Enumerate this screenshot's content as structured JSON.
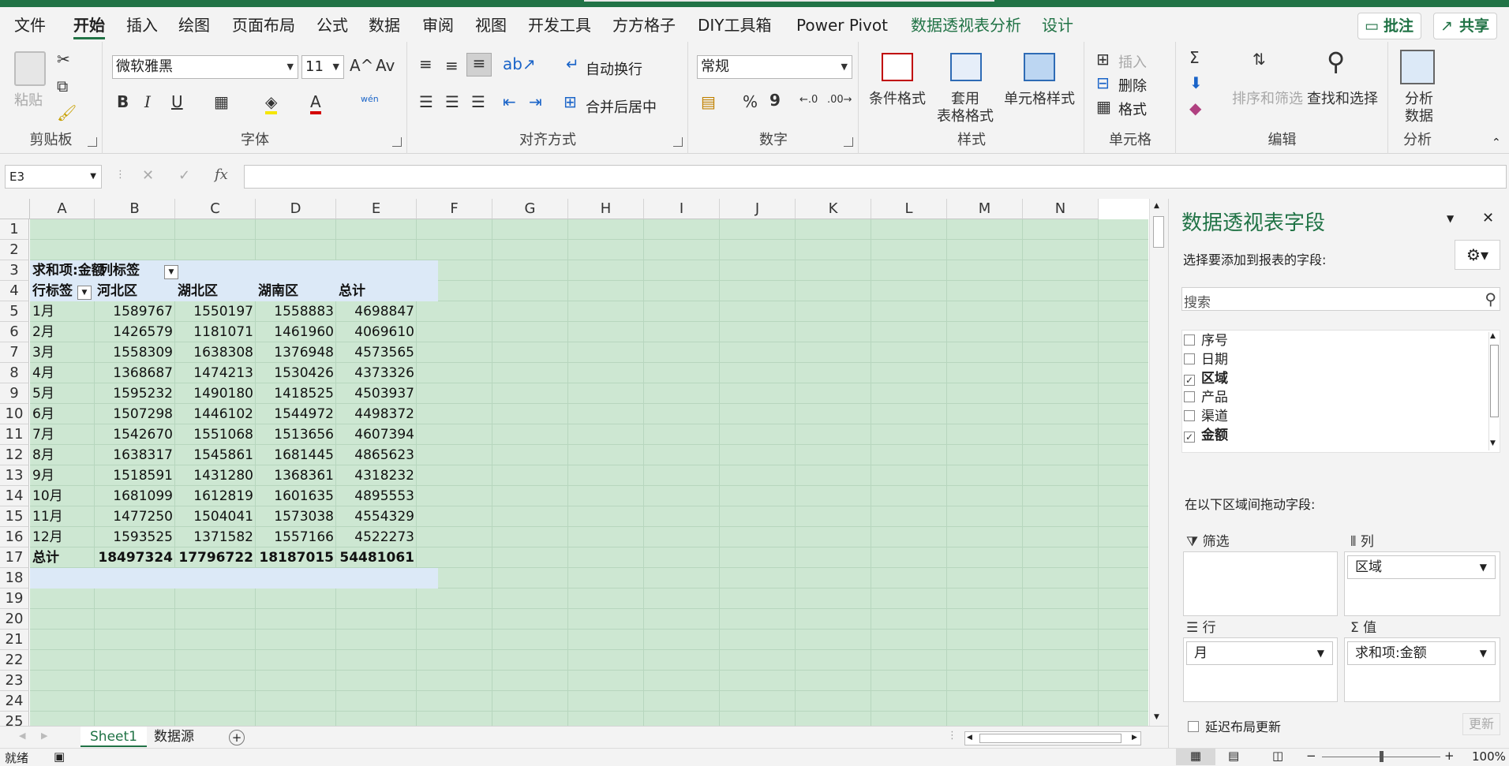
{
  "ribbon_tabs": [
    "文件",
    "开始",
    "插入",
    "绘图",
    "页面布局",
    "公式",
    "数据",
    "审阅",
    "视图",
    "开发工具",
    "方方格子",
    "DIY工具箱",
    "Power Pivot",
    "数据透视表分析",
    "设计"
  ],
  "top_buttons": {
    "comment": "批注",
    "share": "共享",
    "comment_icon": "comment-icon",
    "share_icon": "share-icon"
  },
  "groups": {
    "clipboard": {
      "label": "剪贴板",
      "paste": "粘贴"
    },
    "font": {
      "label": "字体",
      "name": "微软雅黑",
      "size": "11",
      "bold": "B",
      "italic": "I",
      "underline": "U",
      "grow": "A^",
      "shrink": "Av",
      "phonetic": "wén"
    },
    "alignment": {
      "label": "对齐方式",
      "wrap": "自动换行",
      "merge": "合并后居中"
    },
    "number": {
      "label": "数字",
      "format": "常规",
      "percent": "%",
      "comma": "9"
    },
    "styles": {
      "label": "样式",
      "conditional": "条件格式",
      "table_line1": "套用",
      "table_line2": "表格格式",
      "cell_styles": "单元格样式"
    },
    "cells": {
      "label": "单元格",
      "insert": "插入",
      "delete": "删除",
      "format": "格式"
    },
    "editing": {
      "label": "编辑",
      "sort": "排序和筛选",
      "find": "查找和选择"
    },
    "analysis": {
      "label": "分析",
      "analyze_line1": "分析",
      "analyze_line2": "数据"
    }
  },
  "formula_bar": {
    "name_box": "E3",
    "fx": "fx",
    "value": ""
  },
  "columns": [
    "A",
    "B",
    "C",
    "D",
    "E",
    "F",
    "G",
    "H",
    "I",
    "J",
    "K",
    "L",
    "M",
    "N"
  ],
  "rows": [
    "1",
    "2",
    "3",
    "4",
    "5",
    "6",
    "7",
    "8",
    "9",
    "10",
    "11",
    "12",
    "13",
    "14",
    "15",
    "16",
    "17",
    "18",
    "19",
    "20",
    "21",
    "22",
    "23",
    "24",
    "25"
  ],
  "pivot": {
    "value_label": "求和项:金额",
    "col_label": "列标签",
    "row_label": "行标签",
    "headers": [
      "河北区",
      "湖北区",
      "湖南区",
      "总计"
    ],
    "data": [
      [
        "1月",
        "1589767",
        "1550197",
        "1558883",
        "4698847"
      ],
      [
        "2月",
        "1426579",
        "1181071",
        "1461960",
        "4069610"
      ],
      [
        "3月",
        "1558309",
        "1638308",
        "1376948",
        "4573565"
      ],
      [
        "4月",
        "1368687",
        "1474213",
        "1530426",
        "4373326"
      ],
      [
        "5月",
        "1595232",
        "1490180",
        "1418525",
        "4503937"
      ],
      [
        "6月",
        "1507298",
        "1446102",
        "1544972",
        "4498372"
      ],
      [
        "7月",
        "1542670",
        "1551068",
        "1513656",
        "4607394"
      ],
      [
        "8月",
        "1638317",
        "1545861",
        "1681445",
        "4865623"
      ],
      [
        "9月",
        "1518591",
        "1431280",
        "1368361",
        "4318232"
      ],
      [
        "10月",
        "1681099",
        "1612819",
        "1601635",
        "4895553"
      ],
      [
        "11月",
        "1477250",
        "1504041",
        "1573038",
        "4554329"
      ],
      [
        "12月",
        "1593525",
        "1371582",
        "1557166",
        "4522273"
      ]
    ],
    "total": [
      "总计",
      "18497324",
      "17796722",
      "18187015",
      "54481061"
    ]
  },
  "sheet_tabs": [
    "Sheet1",
    "数据源"
  ],
  "status": {
    "ready": "就绪",
    "zoom": "100%"
  },
  "pane": {
    "title": "数据透视表字段",
    "subtitle": "选择要添加到报表的字段:",
    "search_placeholder": "搜索",
    "fields": [
      {
        "name": "序号",
        "checked": false
      },
      {
        "name": "日期",
        "checked": false
      },
      {
        "name": "区域",
        "checked": true
      },
      {
        "name": "产品",
        "checked": false
      },
      {
        "name": "渠道",
        "checked": false
      },
      {
        "name": "金额",
        "checked": true
      }
    ],
    "drag_hint": "在以下区域间拖动字段:",
    "filter_label": "筛选",
    "columns_label": "列",
    "columns_value": "区域",
    "rows_label": "行",
    "rows_value": "月",
    "values_label": "值",
    "values_value": "求和项:金额",
    "defer_label": "延迟布局更新",
    "update_label": "更新"
  }
}
